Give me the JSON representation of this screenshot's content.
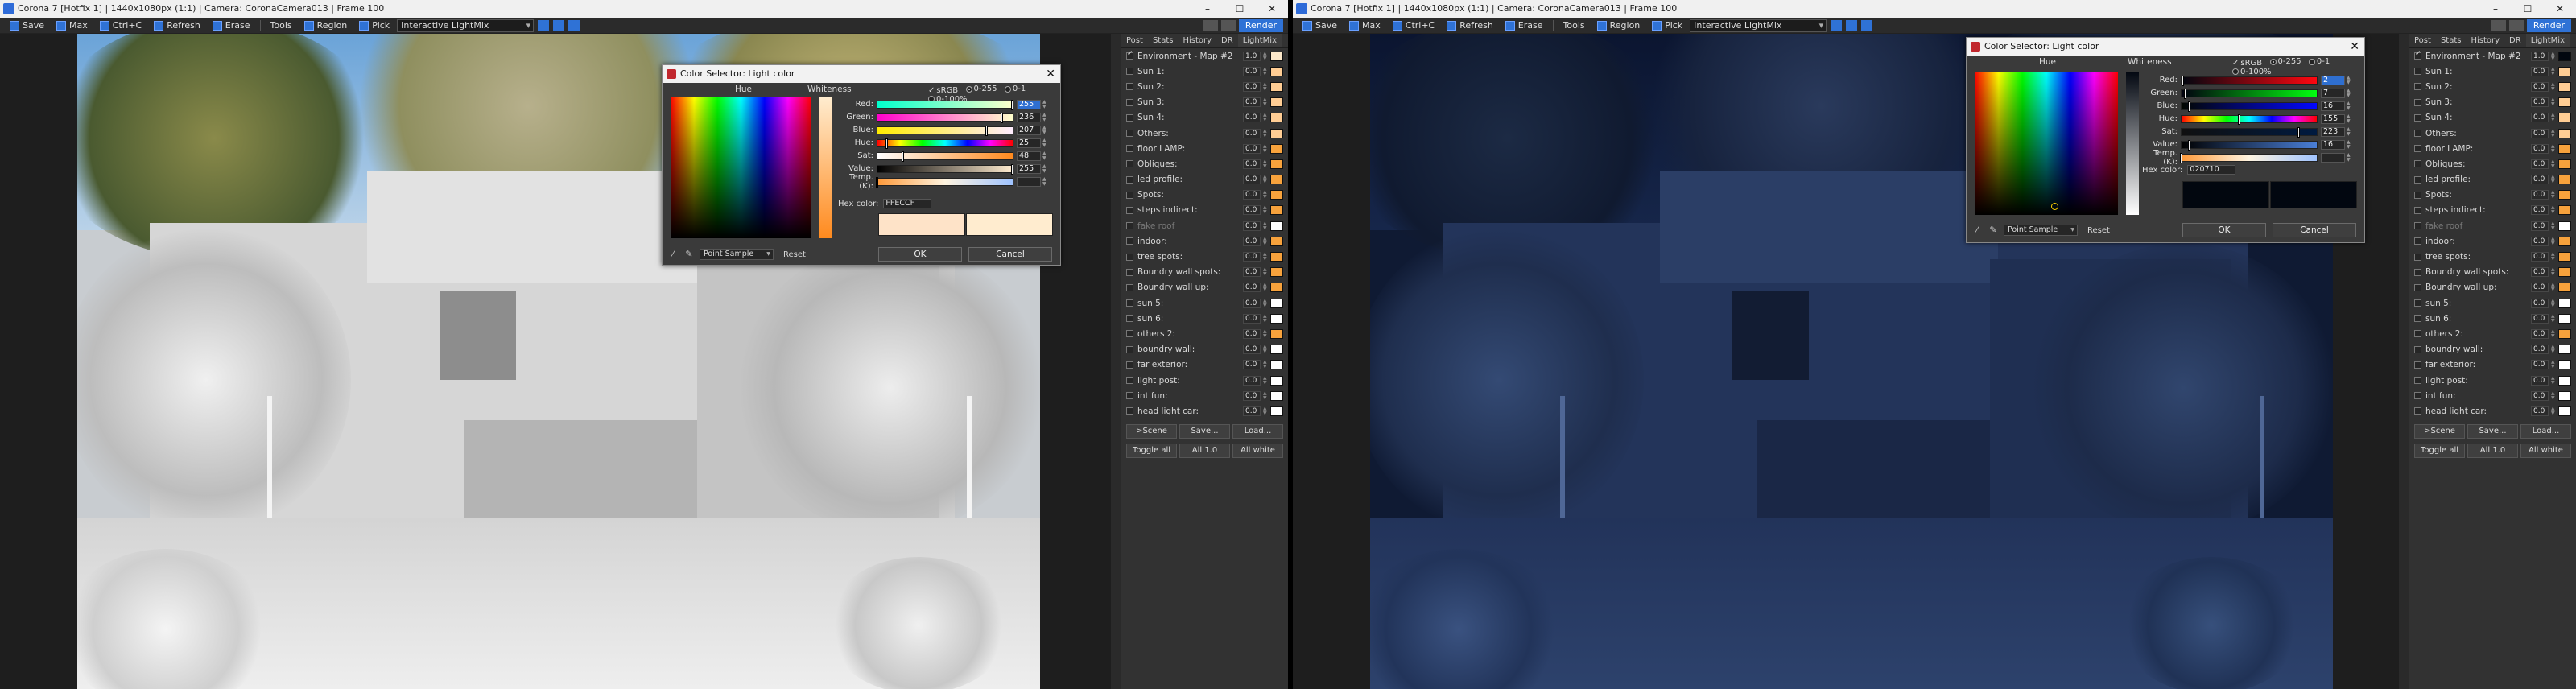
{
  "left": {
    "title": "Corona 7 [Hotfix 1] | 1440x1080px (1:1) | Camera: CoronaCamera013 | Frame 100",
    "toolbar": {
      "save": "Save",
      "max": "Max",
      "copy": "Ctrl+C",
      "refresh": "Refresh",
      "erase": "Erase",
      "tools": "Tools",
      "region": "Region",
      "pick": "Pick",
      "mode": "Interactive LightMix",
      "render": "Render"
    },
    "panel": {
      "tabs": [
        "Post",
        "Stats",
        "History",
        "DR",
        "LightMix"
      ],
      "rows": [
        {
          "label": "Environment - Map #2",
          "value": "1.0",
          "color": "#fbe7c9",
          "on": true,
          "dim": false
        },
        {
          "label": "Sun 1:",
          "value": "0.0",
          "color": "#ffcd94",
          "on": false,
          "dim": false
        },
        {
          "label": "Sun 2:",
          "value": "0.0",
          "color": "#ffcd94",
          "on": false,
          "dim": false
        },
        {
          "label": "Sun 3:",
          "value": "0.0",
          "color": "#ffcd94",
          "on": false,
          "dim": false
        },
        {
          "label": "Sun 4:",
          "value": "0.0",
          "color": "#ffcd94",
          "on": false,
          "dim": false
        },
        {
          "label": "Others:",
          "value": "0.0",
          "color": "#ffcd94",
          "on": false,
          "dim": false
        },
        {
          "label": "floor LAMP:",
          "value": "0.0",
          "color": "#f7a23c",
          "on": false,
          "dim": false
        },
        {
          "label": "Obliques:",
          "value": "0.0",
          "color": "#f7a23c",
          "on": false,
          "dim": false
        },
        {
          "label": "led profile:",
          "value": "0.0",
          "color": "#f7a23c",
          "on": false,
          "dim": false
        },
        {
          "label": "Spots:",
          "value": "0.0",
          "color": "#f7a23c",
          "on": false,
          "dim": false
        },
        {
          "label": "steps indirect:",
          "value": "0.0",
          "color": "#f7a23c",
          "on": false,
          "dim": false
        },
        {
          "label": "fake roof",
          "value": "0.0",
          "color": "#ffffff",
          "on": false,
          "dim": true
        },
        {
          "label": "indoor:",
          "value": "0.0",
          "color": "#f7a23c",
          "on": false,
          "dim": false
        },
        {
          "label": "tree spots:",
          "value": "0.0",
          "color": "#f7a23c",
          "on": false,
          "dim": false
        },
        {
          "label": "Boundry wall spots:",
          "value": "0.0",
          "color": "#f7a23c",
          "on": false,
          "dim": false
        },
        {
          "label": "Boundry wall up:",
          "value": "0.0",
          "color": "#f7a23c",
          "on": false,
          "dim": false
        },
        {
          "label": "sun 5:",
          "value": "0.0",
          "color": "#ffffff",
          "on": false,
          "dim": false
        },
        {
          "label": "sun 6:",
          "value": "0.0",
          "color": "#ffffff",
          "on": false,
          "dim": false
        },
        {
          "label": "others 2:",
          "value": "0.0",
          "color": "#f7a23c",
          "on": false,
          "dim": false
        },
        {
          "label": "boundry wall:",
          "value": "0.0",
          "color": "#ffffff",
          "on": false,
          "dim": false
        },
        {
          "label": "far exterior:",
          "value": "0.0",
          "color": "#ffffff",
          "on": false,
          "dim": false
        },
        {
          "label": "light post:",
          "value": "0.0",
          "color": "#ffffff",
          "on": false,
          "dim": false
        },
        {
          "label": "int fun:",
          "value": "0.0",
          "color": "#ffffff",
          "on": false,
          "dim": false
        },
        {
          "label": "head light car:",
          "value": "0.0",
          "color": "#ffffff",
          "on": false,
          "dim": false
        }
      ],
      "btn_scene": ">Scene",
      "btn_save": "Save...",
      "btn_load": "Load...",
      "btn_toggle": "Toggle all",
      "btn_all1": "All 1.0",
      "btn_allwhite": "All white"
    },
    "dialog": {
      "title": "Color Selector: Light color",
      "hue_label": "Hue",
      "whiteness_label": "Whiteness",
      "srgb": "sRGB",
      "mode1": "0-255",
      "mode2": "0-1",
      "mode3": "0-100%",
      "rows": [
        {
          "label": "Red:",
          "value": "255",
          "fill": 1.0,
          "sel": true,
          "bar": "linear-gradient(90deg,#00ffcc,#ffffcc)"
        },
        {
          "label": "Green:",
          "value": "236",
          "fill": 0.925,
          "sel": false,
          "bar": "linear-gradient(90deg,#ff00cc,#ffffcc)"
        },
        {
          "label": "Blue:",
          "value": "207",
          "fill": 0.81,
          "sel": false,
          "bar": "linear-gradient(90deg,#ffec00,#ffecff)"
        },
        {
          "label": "Hue:",
          "value": "25",
          "fill": 0.07,
          "sel": false,
          "bar": "linear-gradient(90deg,#f00,#ff0,#0f0,#0ff,#00f,#f0f,#f00)"
        },
        {
          "label": "Sat:",
          "value": "48",
          "fill": 0.19,
          "sel": false,
          "bar": "linear-gradient(90deg,#fff,#ff8a1e)"
        },
        {
          "label": "Value:",
          "value": "255",
          "fill": 1.0,
          "sel": false,
          "bar": "linear-gradient(90deg,#000,#ffecd0)"
        },
        {
          "label": "Temp. (K):",
          "value": "",
          "fill": 0.0,
          "sel": false,
          "bar": "linear-gradient(90deg,#ff9a3a,#fff4e0,#9fc3ff)"
        }
      ],
      "hex_label": "Hex color:",
      "hex_value": "FFECCF",
      "preview_old": "#fee3c8",
      "preview_new": "#ffeccf",
      "sample_mode": "Point Sample",
      "reset": "Reset",
      "ok": "OK",
      "cancel": "Cancel"
    }
  },
  "right": {
    "title": "Corona 7 [Hotfix 1] | 1440x1080px (1:1) | Camera: CoronaCamera013 | Frame 100",
    "toolbar": {
      "save": "Save",
      "max": "Max",
      "copy": "Ctrl+C",
      "refresh": "Refresh",
      "erase": "Erase",
      "tools": "Tools",
      "region": "Region",
      "pick": "Pick",
      "mode": "Interactive LightMix",
      "render": "Render"
    },
    "panel": {
      "tabs": [
        "Post",
        "Stats",
        "History",
        "DR",
        "LightMix"
      ],
      "rows": [
        {
          "label": "Environment - Map #2",
          "value": "1.0",
          "color": "#02070f",
          "on": true,
          "dim": false
        },
        {
          "label": "Sun 1:",
          "value": "0.0",
          "color": "#ffcd94",
          "on": false,
          "dim": false
        },
        {
          "label": "Sun 2:",
          "value": "0.0",
          "color": "#ffcd94",
          "on": false,
          "dim": false
        },
        {
          "label": "Sun 3:",
          "value": "0.0",
          "color": "#ffcd94",
          "on": false,
          "dim": false
        },
        {
          "label": "Sun 4:",
          "value": "0.0",
          "color": "#ffcd94",
          "on": false,
          "dim": false
        },
        {
          "label": "Others:",
          "value": "0.0",
          "color": "#ffcd94",
          "on": false,
          "dim": false
        },
        {
          "label": "floor LAMP:",
          "value": "0.0",
          "color": "#f7a23c",
          "on": false,
          "dim": false
        },
        {
          "label": "Obliques:",
          "value": "0.0",
          "color": "#f7a23c",
          "on": false,
          "dim": false
        },
        {
          "label": "led profile:",
          "value": "0.0",
          "color": "#f7a23c",
          "on": false,
          "dim": false
        },
        {
          "label": "Spots:",
          "value": "0.0",
          "color": "#f7a23c",
          "on": false,
          "dim": false
        },
        {
          "label": "steps indirect:",
          "value": "0.0",
          "color": "#f7a23c",
          "on": false,
          "dim": false
        },
        {
          "label": "fake roof",
          "value": "0.0",
          "color": "#ffffff",
          "on": false,
          "dim": true
        },
        {
          "label": "indoor:",
          "value": "0.0",
          "color": "#f7a23c",
          "on": false,
          "dim": false
        },
        {
          "label": "tree spots:",
          "value": "0.0",
          "color": "#f7a23c",
          "on": false,
          "dim": false
        },
        {
          "label": "Boundry wall spots:",
          "value": "0.0",
          "color": "#f7a23c",
          "on": false,
          "dim": false
        },
        {
          "label": "Boundry wall up:",
          "value": "0.0",
          "color": "#f7a23c",
          "on": false,
          "dim": false
        },
        {
          "label": "sun 5:",
          "value": "0.0",
          "color": "#ffffff",
          "on": false,
          "dim": false
        },
        {
          "label": "sun 6:",
          "value": "0.0",
          "color": "#ffffff",
          "on": false,
          "dim": false
        },
        {
          "label": "others 2:",
          "value": "0.0",
          "color": "#f7a23c",
          "on": false,
          "dim": false
        },
        {
          "label": "boundry wall:",
          "value": "0.0",
          "color": "#ffffff",
          "on": false,
          "dim": false
        },
        {
          "label": "far exterior:",
          "value": "0.0",
          "color": "#ffffff",
          "on": false,
          "dim": false
        },
        {
          "label": "light post:",
          "value": "0.0",
          "color": "#ffffff",
          "on": false,
          "dim": false
        },
        {
          "label": "int fun:",
          "value": "0.0",
          "color": "#ffffff",
          "on": false,
          "dim": false
        },
        {
          "label": "head light car:",
          "value": "0.0",
          "color": "#ffffff",
          "on": false,
          "dim": false
        }
      ],
      "btn_scene": ">Scene",
      "btn_save": "Save...",
      "btn_load": "Load...",
      "btn_toggle": "Toggle all",
      "btn_all1": "All 1.0",
      "btn_allwhite": "All white"
    },
    "dialog": {
      "title": "Color Selector: Light color",
      "hue_label": "Hue",
      "whiteness_label": "Whiteness",
      "srgb": "sRGB",
      "mode1": "0-255",
      "mode2": "0-1",
      "mode3": "0-100%",
      "rows": [
        {
          "label": "Red:",
          "value": "2",
          "fill": 0.01,
          "sel": true,
          "bar": "linear-gradient(90deg,#000710,#ff0710)"
        },
        {
          "label": "Green:",
          "value": "7",
          "fill": 0.03,
          "sel": false,
          "bar": "linear-gradient(90deg,#020010,#02ff10)"
        },
        {
          "label": "Blue:",
          "value": "16",
          "fill": 0.06,
          "sel": false,
          "bar": "linear-gradient(90deg,#020700,#0207ff)"
        },
        {
          "label": "Hue:",
          "value": "155",
          "fill": 0.43,
          "sel": false,
          "bar": "linear-gradient(90deg,#f00,#ff0,#0f0,#0ff,#00f,#f0f,#f00)"
        },
        {
          "label": "Sat:",
          "value": "223",
          "fill": 0.87,
          "sel": false,
          "bar": "linear-gradient(90deg,#101010,#001a40)"
        },
        {
          "label": "Value:",
          "value": "16",
          "fill": 0.06,
          "sel": false,
          "bar": "linear-gradient(90deg,#000,#4a7fd8)"
        },
        {
          "label": "Temp. (K):",
          "value": "",
          "fill": 0.0,
          "sel": false,
          "bar": "linear-gradient(90deg,#ff9a3a,#fff4e0,#9fc3ff)"
        }
      ],
      "hex_label": "Hex color:",
      "hex_value": "020710",
      "preview_old": "#02070f",
      "preview_new": "#020710",
      "sample_mode": "Point Sample",
      "reset": "Reset",
      "ok": "OK",
      "cancel": "Cancel"
    }
  },
  "icons": {
    "eyedropper": "eyedropper-icon",
    "picker": "color-picker-icon",
    "close": "close-icon"
  }
}
